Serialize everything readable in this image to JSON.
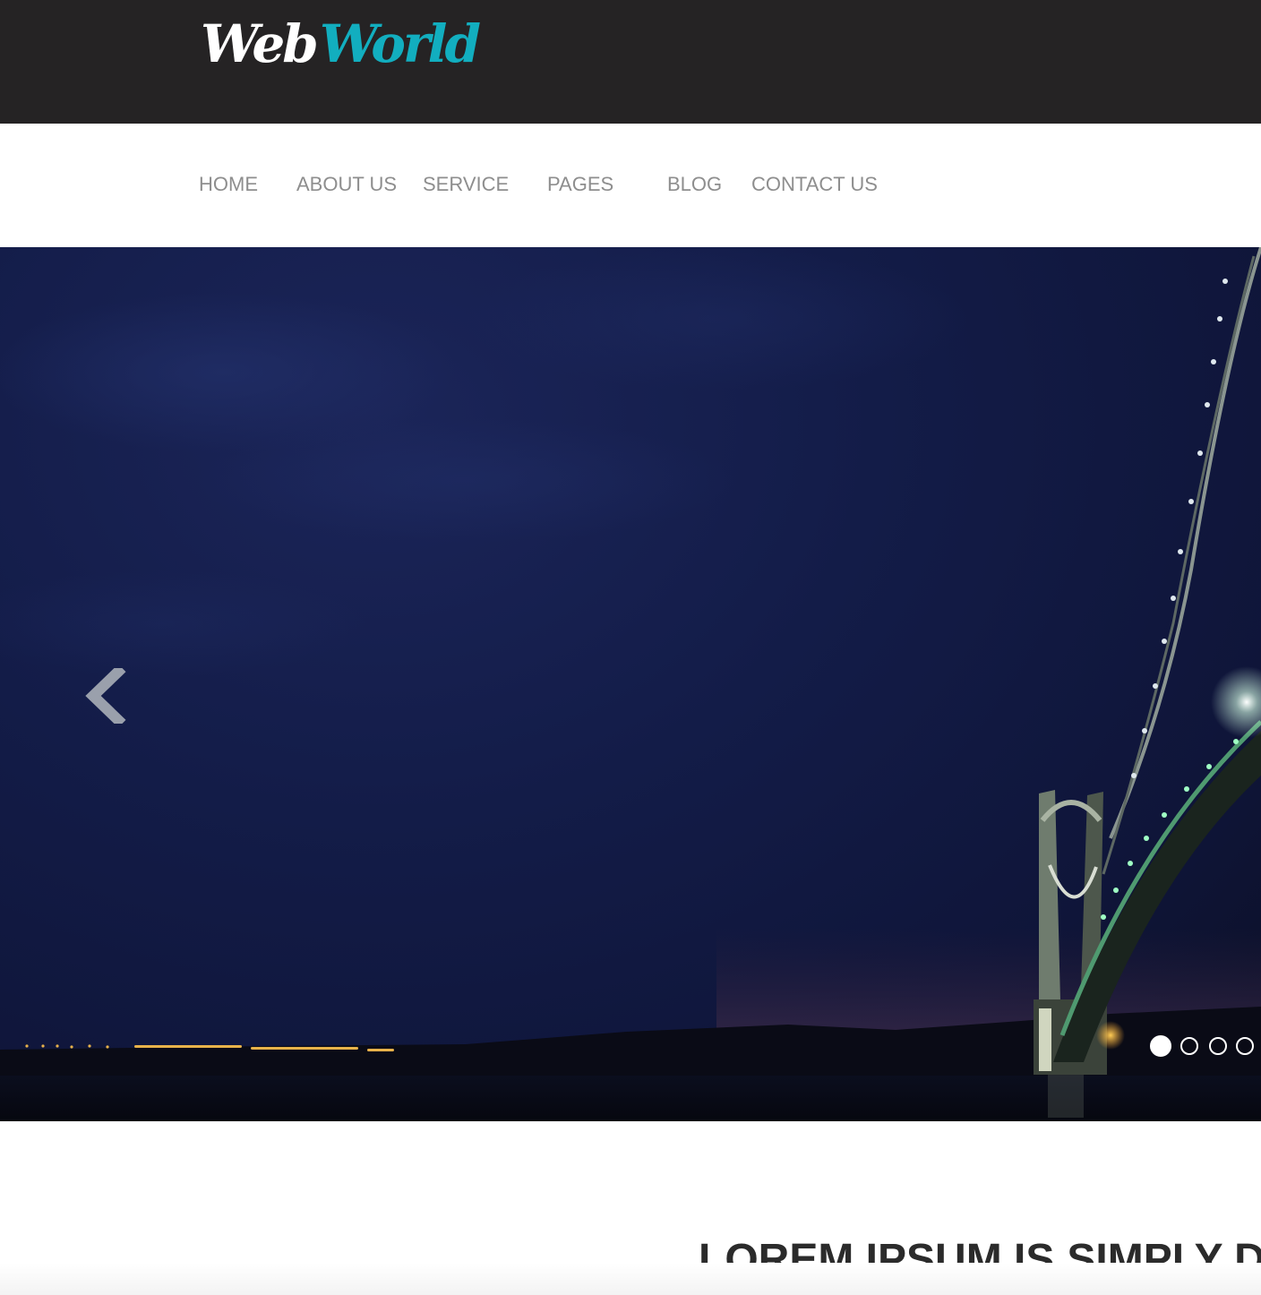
{
  "header": {
    "logo": {
      "part1": "Web",
      "part2": "World"
    },
    "brand_color": "#12aebf",
    "background": "#252324"
  },
  "nav": {
    "items": [
      {
        "label": "HOME"
      },
      {
        "label": "ABOUT US"
      },
      {
        "label": "SERVICE"
      },
      {
        "label": "PAGES"
      },
      {
        "label": "BLOG"
      },
      {
        "label": "CONTACT US"
      }
    ],
    "text_color": "#8e8e8e"
  },
  "hero": {
    "image_subject": "suspension bridge at night",
    "prev_icon": "chevron-left-icon",
    "slides": {
      "count": 4,
      "active_index": 1
    }
  },
  "intro": {
    "headline_light": "LOREM IPSUM IS",
    "headline_bold": "SIMPLY DU"
  }
}
